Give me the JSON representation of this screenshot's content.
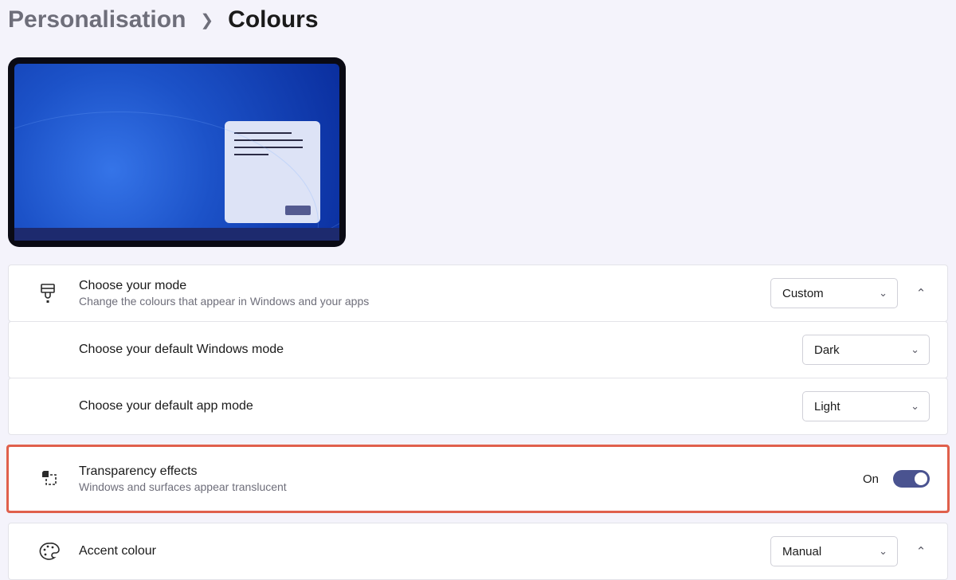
{
  "breadcrumb": {
    "parent": "Personalisation",
    "current": "Colours"
  },
  "mode": {
    "title": "Choose your mode",
    "subtitle": "Change the colours that appear in Windows and your apps",
    "value": "Custom"
  },
  "windows_mode": {
    "title": "Choose your default Windows mode",
    "value": "Dark"
  },
  "app_mode": {
    "title": "Choose your default app mode",
    "value": "Light"
  },
  "transparency": {
    "title": "Transparency effects",
    "subtitle": "Windows and surfaces appear translucent",
    "state_label": "On"
  },
  "accent": {
    "title": "Accent colour",
    "value": "Manual"
  }
}
